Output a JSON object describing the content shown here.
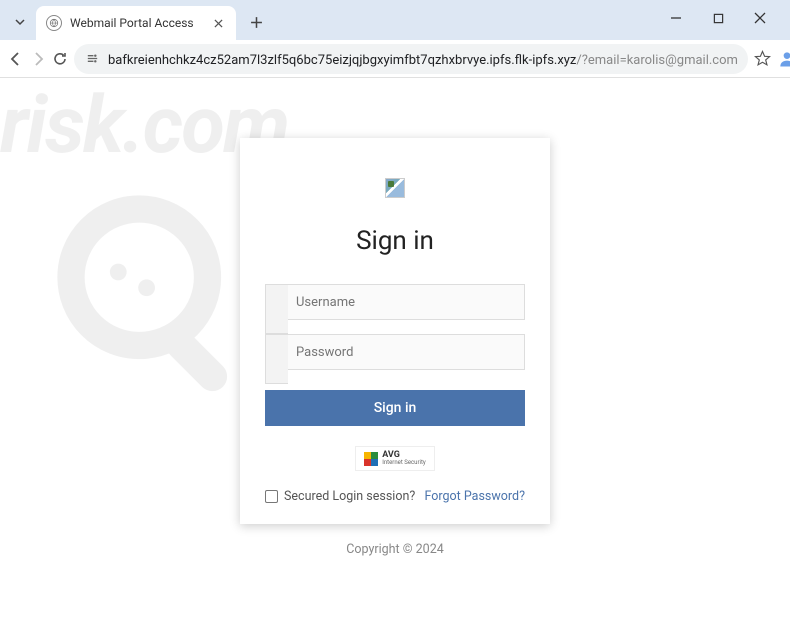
{
  "browser": {
    "tab_title": "Webmail Portal Access",
    "url_host": "bafkreienhchkz4cz52am7l3zlf5q6bc75eizjqjbgxyimfbt7qzhxbrvye.ipfs.flk-ipfs.xyz",
    "url_path": "/?email=karolis@gmail.com"
  },
  "login": {
    "heading": "Sign in",
    "username_placeholder": "Username",
    "password_placeholder": "Password",
    "signin_button": "Sign in",
    "secured_label": "Secured Login session?",
    "forgot_label": "Forgot Password?",
    "badge_name": "AVG",
    "badge_subtitle": "Internet Security"
  },
  "footer": {
    "copyright": "Copyright © 2024"
  },
  "watermark": {
    "text": "risk.com"
  }
}
